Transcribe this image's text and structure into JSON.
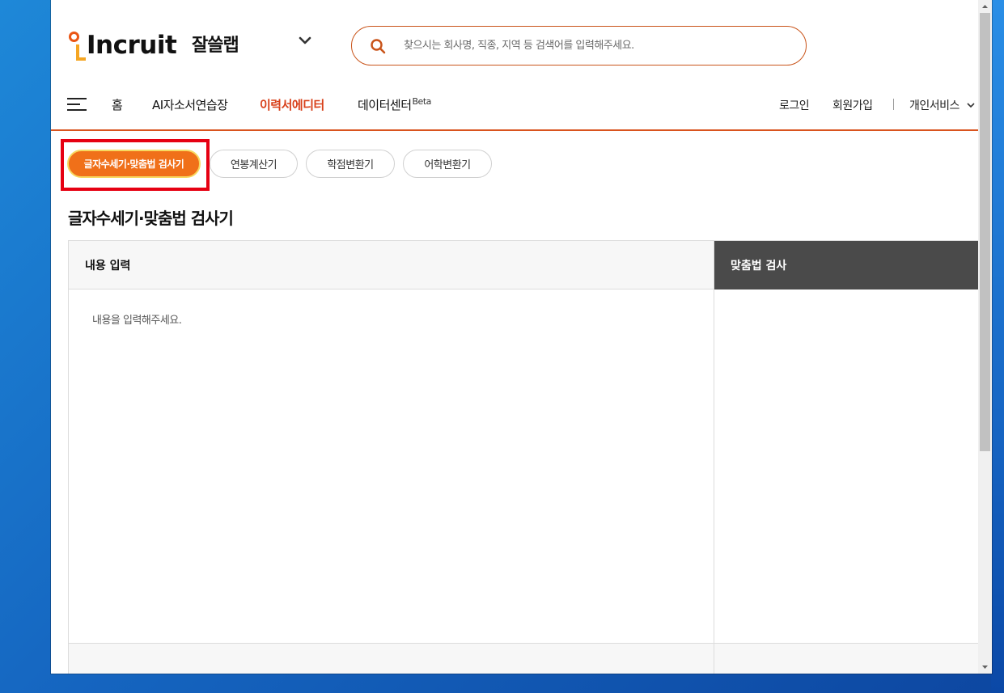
{
  "header": {
    "logo_text": "Incruit",
    "service_name": "잘쓸랩",
    "search_placeholder": "찾으시는 회사명, 직종, 지역 등 검색어를 입력해주세요."
  },
  "nav": {
    "items": [
      {
        "label": "홈"
      },
      {
        "label": "AI자소서연습장"
      },
      {
        "label": "이력서에디터",
        "active": true
      },
      {
        "label": "데이터센터",
        "sup": "Beta"
      }
    ],
    "right": {
      "login": "로그인",
      "signup": "회원가입",
      "personal": "개인서비스"
    }
  },
  "tools": {
    "tabs": [
      {
        "label": "글자수세기·맞춤법 검사기",
        "active": true
      },
      {
        "label": "연봉계산기"
      },
      {
        "label": "학점변환기"
      },
      {
        "label": "어학변환기"
      }
    ]
  },
  "section_title": "글자수세기·맞춤법 검사기",
  "input_panel": {
    "header": "내용 입력",
    "placeholder": "내용을 입력해주세요."
  },
  "spell_panel": {
    "header": "맞춤법 검사"
  },
  "colors": {
    "brand": "#d9541e",
    "active_pill": "#f07019",
    "highlight": "#e60012"
  }
}
